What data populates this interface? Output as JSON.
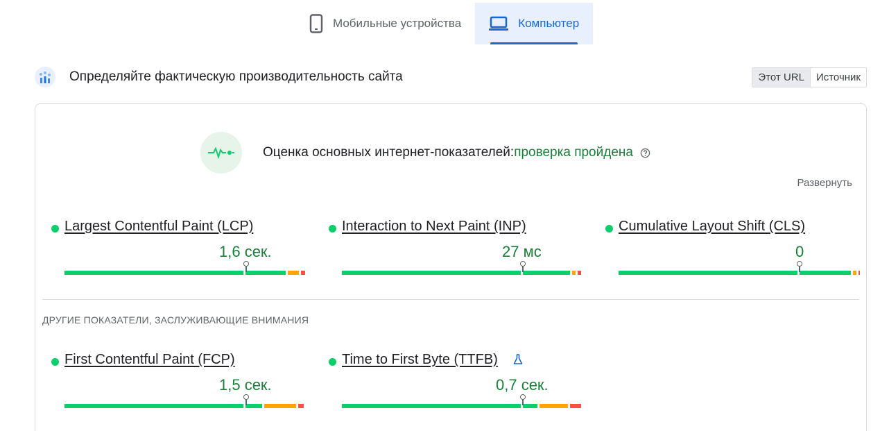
{
  "tabs": [
    {
      "label": "Мобильные устройства",
      "icon": "phone-icon",
      "active": false
    },
    {
      "label": "Компьютер",
      "icon": "laptop-icon",
      "active": true
    }
  ],
  "header": {
    "title": "Определяйте фактическую производительность сайта",
    "toggle": [
      "Этот URL",
      "Источник"
    ],
    "toggle_selected": "Этот URL"
  },
  "assessment": {
    "label": "Оценка основных интернет-показателей:",
    "status": "проверка пройдена",
    "expand_label": "Развернуть"
  },
  "core_metrics": [
    {
      "name": "Largest Contentful Paint (LCP)",
      "value": "1,6 сек.",
      "status": "good"
    },
    {
      "name": "Interaction to Next Paint (INP)",
      "value": "27 мс",
      "status": "good"
    },
    {
      "name": "Cumulative Layout Shift (CLS)",
      "value": "0",
      "status": "good"
    }
  ],
  "other_heading": "ДРУГИЕ ПОКАЗАТЕЛИ, ЗАСЛУЖИВАЮЩИЕ ВНИМАНИЯ",
  "other_metrics": [
    {
      "name": "First Contentful Paint (FCP)",
      "value": "1,5 сек.",
      "status": "good"
    },
    {
      "name": "Time to First Byte (TTFB)",
      "value": "0,7 сек.",
      "status": "good",
      "experimental_icon": "flask-icon"
    }
  ],
  "colors": {
    "good": "#0cce6b",
    "needs_improvement": "#ffa400",
    "poor": "#ff4e42",
    "accent": "#1967d2",
    "pass_text": "#188038"
  }
}
